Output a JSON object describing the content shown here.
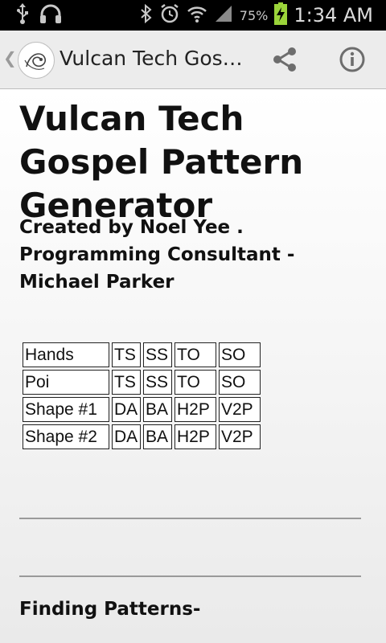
{
  "status_bar": {
    "battery_percent": "75%",
    "time": "1:34 AM",
    "icons": [
      "usb-icon",
      "headset-icon",
      "bluetooth-icon",
      "alarm-icon",
      "wifi-icon",
      "signal-icon",
      "battery-charging-icon"
    ]
  },
  "action_bar": {
    "title": "Vulcan Tech Gos…",
    "actions": [
      "share-icon",
      "info-icon"
    ]
  },
  "main": {
    "heading": "Vulcan Tech Gospel Pattern Generator",
    "credits": "Created by Noel Yee . Programming Consultant - Michael Parker",
    "table": {
      "rows": [
        [
          "Hands",
          "TS",
          "SS",
          "TO",
          "SO"
        ],
        [
          "Poi",
          "TS",
          "SS",
          "TO",
          "SO"
        ],
        [
          "Shape #1",
          "DA",
          "BA",
          "H2P",
          "V2P"
        ],
        [
          "Shape #2",
          "DA",
          "BA",
          "H2P",
          "V2P"
        ]
      ]
    },
    "section_title": "Finding Patterns-"
  },
  "colors": {
    "status_bar_bg": "#000000",
    "action_bar_bg": "#ececec",
    "battery_accent": "#9bd43a"
  }
}
